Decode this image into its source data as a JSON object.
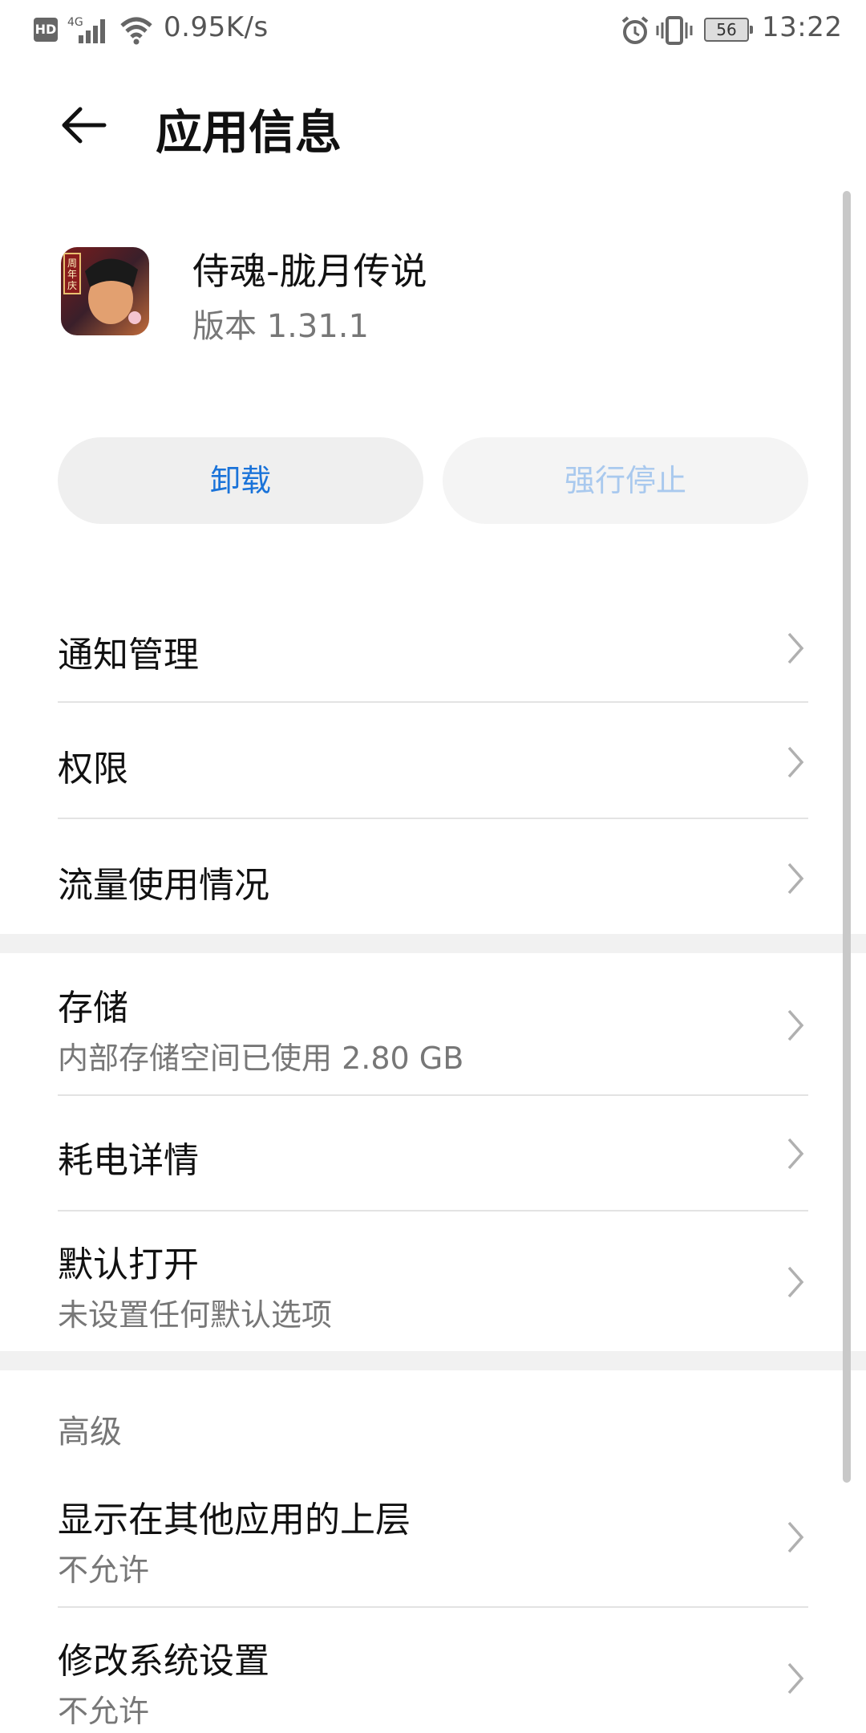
{
  "status_bar": {
    "net_speed": "0.95K/s",
    "network": "4G",
    "hd_label": "HD",
    "battery": "56",
    "time": "13:22"
  },
  "header": {
    "title": "应用信息"
  },
  "app": {
    "name": "侍魂-胧月传说",
    "version": "版本 1.31.1",
    "icon_badge": "周年庆"
  },
  "buttons": {
    "uninstall": "卸载",
    "force_stop": "强行停止"
  },
  "list": {
    "notifications": "通知管理",
    "permissions": "权限",
    "data_usage": "流量使用情况",
    "storage": {
      "title": "存储",
      "subtitle": "内部存储空间已使用 2.80 GB"
    },
    "battery": "耗电详情",
    "open_default": {
      "title": "默认打开",
      "subtitle": "未设置任何默认选项"
    },
    "advanced_label": "高级",
    "overlay": {
      "title": "显示在其他应用的上层",
      "subtitle": "不允许"
    },
    "modify_settings": {
      "title": "修改系统设置",
      "subtitle": "不允许"
    }
  }
}
